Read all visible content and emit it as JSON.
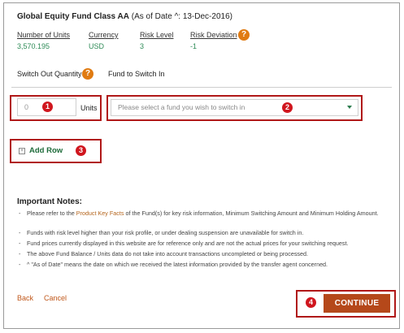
{
  "fund": {
    "name": "Global Equity Fund Class AA",
    "as_of": "(As of Date ^: 13-Dec-2016)"
  },
  "summary": {
    "units_label": "Number of Units",
    "units_value": "3,570.195",
    "currency_label": "Currency",
    "currency_value": "USD",
    "risk_label": "Risk Level",
    "risk_value": "3",
    "deviation_label": "Risk Deviation",
    "deviation_value": "-1"
  },
  "help_icon": "?",
  "switch": {
    "out_label": "Switch Out Quantity",
    "in_label": "Fund to Switch In",
    "qty_placeholder": "0",
    "units_text": "Units",
    "fund_placeholder": "Please select a fund you wish to switch in",
    "add_row": "Add Row"
  },
  "badges": [
    "1",
    "2",
    "3",
    "4"
  ],
  "notes": {
    "heading": "Important Notes:",
    "items": [
      {
        "pre": "Please refer to the ",
        "link": "Product Key Facts",
        "post": " of the Fund(s) for key risk information, Minimum Switching Amount and Minimum Holding Amount."
      },
      {
        "text": "Funds with risk level higher than your risk profile, or under dealing suspension are unavailable for switch in."
      },
      {
        "text": "Fund prices currently displayed in this website are for reference only and are not the actual prices for your switching request."
      },
      {
        "text": "The above Fund Balance / Units data do not take into account transactions uncompleted or being processed."
      },
      {
        "text": "^ \"As of Date\" means the date on which we received the latest information provided by the transfer agent concerned."
      }
    ]
  },
  "footer": {
    "back": "Back",
    "cancel": "Cancel",
    "continue": "CONTINUE"
  },
  "colors": {
    "accent_green": "#2e8b57",
    "help_orange": "#e07b12",
    "annotation_red": "#d0161e",
    "continue_bg": "#b5481a"
  }
}
